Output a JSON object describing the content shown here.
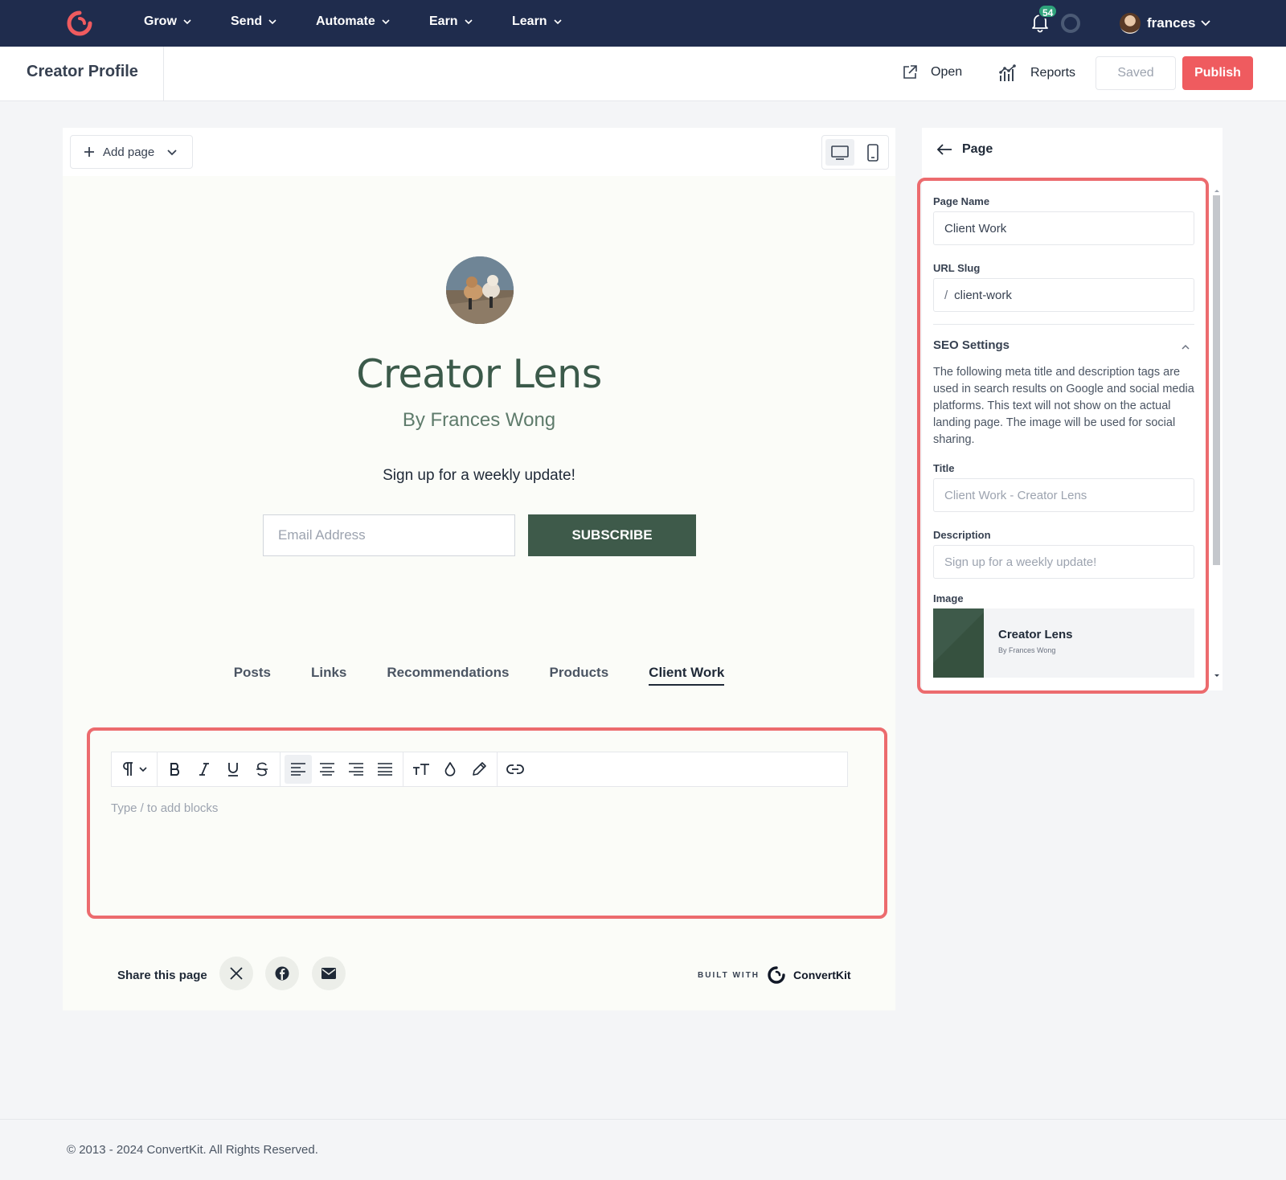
{
  "topnav": {
    "menu": [
      {
        "label": "Grow"
      },
      {
        "label": "Send"
      },
      {
        "label": "Automate"
      },
      {
        "label": "Earn"
      },
      {
        "label": "Learn"
      }
    ],
    "notification_count": "54",
    "user_name": "frances"
  },
  "header": {
    "title": "Creator Profile",
    "open_label": "Open",
    "reports_label": "Reports",
    "saved_label": "Saved",
    "publish_label": "Publish"
  },
  "canvas": {
    "add_page_label": "Add page",
    "site_title": "Creator Lens",
    "byline": "By Frances Wong",
    "cta": "Sign up for a weekly update!",
    "email_placeholder": "Email Address",
    "subscribe_label": "SUBSCRIBE",
    "tabs": [
      {
        "label": "Posts",
        "active": false
      },
      {
        "label": "Links",
        "active": false
      },
      {
        "label": "Recommendations",
        "active": false
      },
      {
        "label": "Products",
        "active": false
      },
      {
        "label": "Client Work",
        "active": true
      }
    ],
    "editor_placeholder": "Type / to add blocks",
    "share_label": "Share this page",
    "built_with": "BUILT WITH",
    "brand": "ConvertKit"
  },
  "panel": {
    "heading": "Page",
    "page_name_label": "Page Name",
    "page_name_value": "Client Work",
    "url_slug_label": "URL Slug",
    "url_slug_prefix": "/",
    "url_slug_value": "client-work",
    "seo_heading": "SEO Settings",
    "seo_description": "The following meta title and description tags are used in search results on Google and social media platforms. This text will not show on the actual landing page. The image will be used for social sharing.",
    "title_label": "Title",
    "title_placeholder": "Client Work - Creator Lens",
    "description_label": "Description",
    "description_placeholder": "Sign up for a weekly update!",
    "image_label": "Image",
    "image_title": "Creator Lens",
    "image_subtitle": "By Frances Wong"
  },
  "footer": {
    "copyright": "© 2013 - 2024 ConvertKit. All Rights Reserved."
  },
  "colors": {
    "nav_bg": "#1f2c4d",
    "brand_red": "#ef5b5f",
    "highlight": "#ec6b6e",
    "site_green": "#3e5a4a"
  }
}
